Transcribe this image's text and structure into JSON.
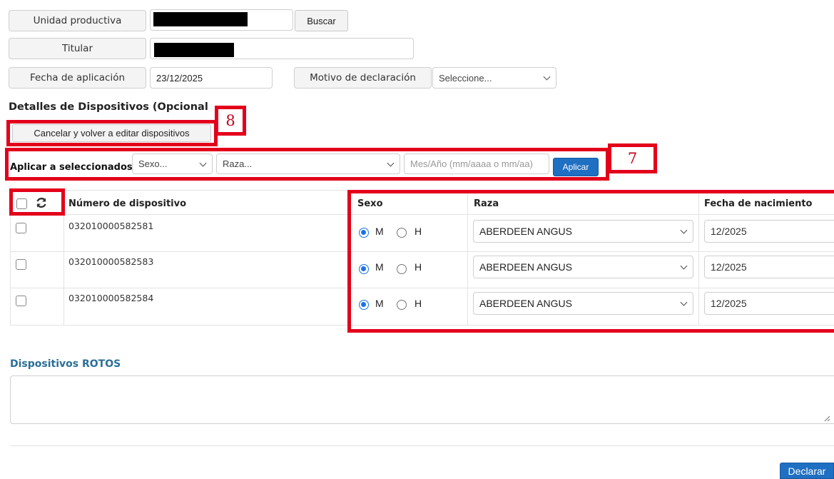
{
  "form": {
    "unidad_label": "Unidad productiva",
    "buscar": "Buscar",
    "titular_label": "Titular",
    "fecha_label": "Fecha de aplicación",
    "fecha_value": "23/12/2025",
    "motivo_label": "Motivo de declaración",
    "motivo_value": "Seleccione..."
  },
  "details": {
    "title": "Detalles de Dispositivos (Opcional",
    "cancel_button": "Cancelar y volver a editar dispositivos",
    "apply_label": "Aplicar a seleccionados:",
    "sexo_select": "Sexo...",
    "raza_select": "Raza...",
    "date_placeholder": "Mes/Año (mm/aaaa o mm/aa)",
    "apply_button": "Aplicar"
  },
  "annotations": {
    "box8": "8",
    "box7": "7"
  },
  "table": {
    "headers": {
      "number": "Número de dispositivo",
      "sexo": "Sexo",
      "raza": "Raza",
      "fecha": "Fecha de nacimiento"
    },
    "rows": [
      {
        "number": "032010000582581",
        "m": "M",
        "h": "H",
        "raza": "ABERDEEN ANGUS",
        "fecha": "12/2025"
      },
      {
        "number": "032010000582583",
        "m": "M",
        "h": "H",
        "raza": "ABERDEEN ANGUS",
        "fecha": "12/2025"
      },
      {
        "number": "032010000582584",
        "m": "M",
        "h": "H",
        "raza": "ABERDEEN ANGUS",
        "fecha": "12/2025"
      }
    ]
  },
  "rotos": {
    "title": "Dispositivos ROTOS"
  },
  "footer": {
    "declarar": "Declarar"
  },
  "colors": {
    "annotation_red": "#e3001b",
    "primary_blue": "#1f6fc2",
    "section_title_blue": "#2a6f97"
  }
}
